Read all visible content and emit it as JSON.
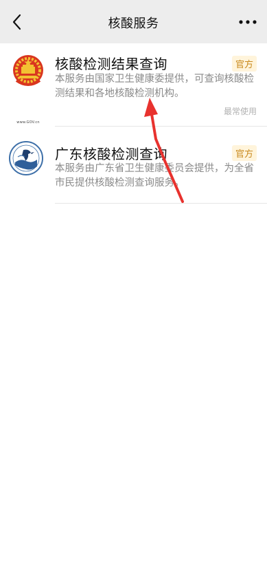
{
  "header": {
    "title": "核酸服务",
    "back_icon": "chevron-left-icon",
    "more_icon": "more-dots-icon"
  },
  "services": [
    {
      "title": "核酸检测结果查询",
      "badge": "官方",
      "description": "本服务由国家卫生健康委提供，可查询核酸检测结果和各地核酸检测机构。",
      "note": "最常使用",
      "logo_caption": "www.GOV.cn",
      "icon": "national-emblem-icon"
    },
    {
      "title": "广东核酸检测查询",
      "badge": "官方",
      "description": "本服务由广东省卫生健康委员会提供，为全省市民提供核酸检测查询服务。",
      "icon": "guangdong-health-logo-icon"
    }
  ],
  "colors": {
    "nav_bg": "#ededed",
    "badge_text": "#c8891d",
    "badge_bg": "#fff4db",
    "annotation_arrow": "#e8322e"
  }
}
